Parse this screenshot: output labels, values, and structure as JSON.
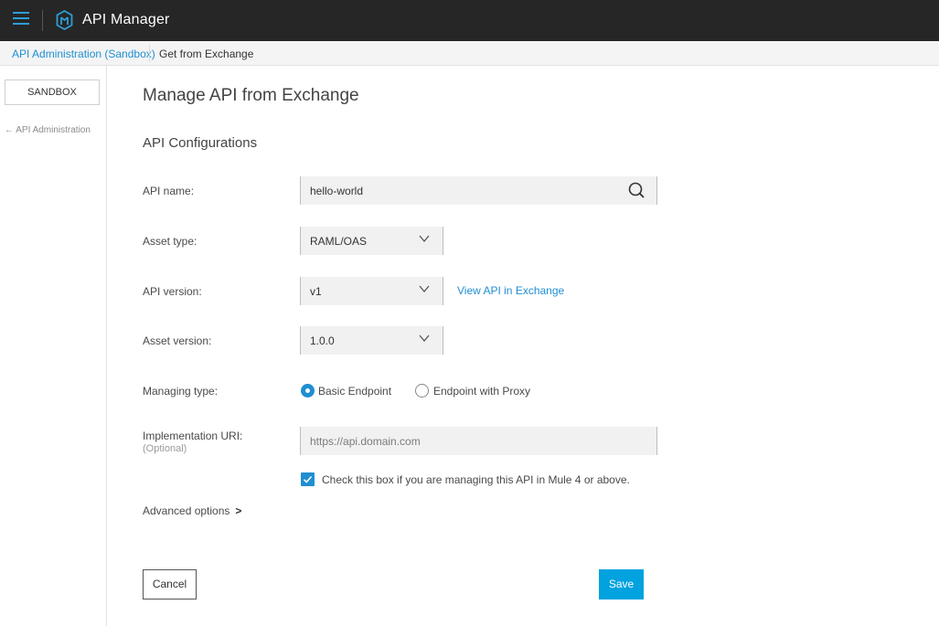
{
  "header": {
    "app_title": "API Manager",
    "menu_icon": "hamburger-menu-icon",
    "logo_icon": "api-manager-logo-icon",
    "accent_color": "#2e9ed8"
  },
  "breadcrumb": {
    "parent": "API Administration (Sandbox)",
    "current": "Get from Exchange"
  },
  "sidebar": {
    "environment": "SANDBOX",
    "back_link": "← API Administration"
  },
  "main": {
    "page_title": "Manage API from Exchange",
    "section_title": "API Configurations",
    "fields": {
      "api_name": {
        "label": "API name:",
        "value": "hello-world",
        "icon": "search-icon"
      },
      "asset_type": {
        "label": "Asset type:",
        "value": "RAML/OAS",
        "icon": "chevron-down-icon"
      },
      "api_version": {
        "label": "API version:",
        "value": "v1",
        "icon": "chevron-down-icon"
      },
      "asset_version": {
        "label": "Asset version:",
        "value": "1.0.0",
        "icon": "chevron-down-icon"
      },
      "managing_type": {
        "label": "Managing type:",
        "options": [
          "Basic Endpoint",
          "Endpoint with Proxy"
        ],
        "selected": "Basic Endpoint"
      },
      "implementation_uri": {
        "label": "Implementation URI:",
        "optional": "(Optional)",
        "placeholder": "https://api.domain.com"
      }
    },
    "view_in_exchange": "View API in Exchange",
    "mule4_checkbox": {
      "label": "Check this box if you are managing this API in Mule 4 or above.",
      "checked": true
    },
    "advanced_options": {
      "label": "Advanced options",
      "arrow": ">"
    },
    "buttons": {
      "cancel": "Cancel",
      "save": "Save"
    },
    "colors": {
      "link": "#1f8fd1",
      "primary_button": "#00a2df",
      "topbar": "#262626"
    }
  }
}
